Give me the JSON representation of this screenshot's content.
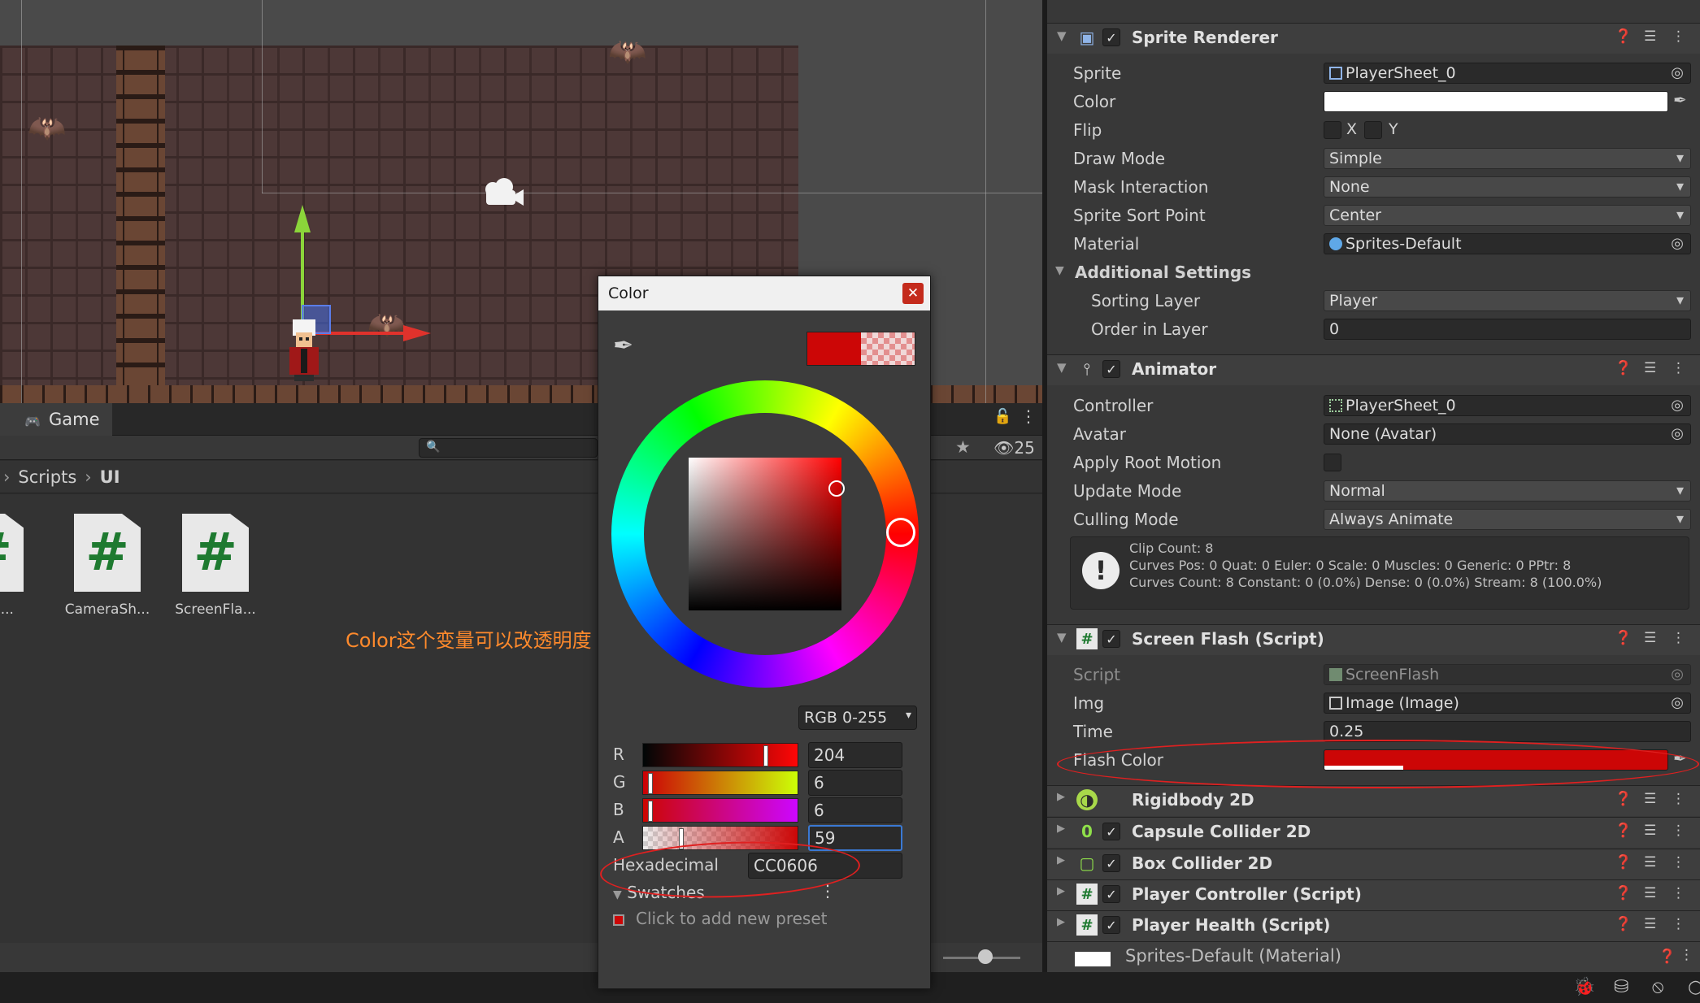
{
  "scene": {
    "game_tab_label": "Game",
    "visibility_count": "25"
  },
  "project": {
    "breadcrumb": [
      "Scripts",
      "UI"
    ],
    "assets": [
      {
        "name": "raFol...",
        "icon": "csharp-script-icon"
      },
      {
        "name": "CameraSh...",
        "icon": "csharp-script-icon"
      },
      {
        "name": "ScreenFla...",
        "icon": "csharp-script-icon"
      }
    ],
    "annotation_note": "Color这个变量可以改透明度"
  },
  "color_picker": {
    "title": "Color",
    "mode": "RGB 0-255",
    "channels": [
      {
        "label": "R",
        "value": "204",
        "level": 0.8
      },
      {
        "label": "G",
        "value": "6",
        "level": 0.024
      },
      {
        "label": "B",
        "value": "6",
        "level": 0.024
      },
      {
        "label": "A",
        "value": "59",
        "level": 0.231
      }
    ],
    "hex_label": "Hexadecimal",
    "hex_value": "CC0606",
    "swatches_label": "Swatches",
    "add_preset_label": "Click to add new preset",
    "current_color": "#cc0606"
  },
  "inspector": {
    "sprite_renderer": {
      "title": "Sprite Renderer",
      "props": [
        {
          "label": "Sprite",
          "value": "PlayerSheet_0"
        },
        {
          "label": "Color",
          "value": ""
        },
        {
          "label": "Flip",
          "value": ""
        },
        {
          "label": "Draw Mode",
          "value": "Simple"
        },
        {
          "label": "Mask Interaction",
          "value": "None"
        },
        {
          "label": "Sprite Sort Point",
          "value": "Center"
        },
        {
          "label": "Material",
          "value": "Sprites-Default"
        }
      ],
      "flip_x": "X",
      "flip_y": "Y",
      "additional_settings": "Additional Settings",
      "sorting_layer_label": "Sorting Layer",
      "sorting_layer_value": "Player",
      "order_label": "Order in Layer",
      "order_value": "0"
    },
    "animator": {
      "title": "Animator",
      "props": [
        {
          "label": "Controller",
          "value": "PlayerSheet_0"
        },
        {
          "label": "Avatar",
          "value": "None (Avatar)"
        },
        {
          "label": "Apply Root Motion",
          "value": ""
        },
        {
          "label": "Update Mode",
          "value": "Normal"
        },
        {
          "label": "Culling Mode",
          "value": "Always Animate"
        }
      ],
      "info_lines": [
        "Clip Count: 8",
        "Curves Pos: 0 Quat: 0 Euler: 0 Scale: 0 Muscles: 0 Generic: 0 PPtr: 8",
        "Curves Count: 8 Constant: 0 (0.0%) Dense: 0 (0.0%) Stream: 8 (100.0%)"
      ]
    },
    "screen_flash": {
      "title": "Screen Flash (Script)",
      "props": [
        {
          "label": "Script",
          "value": "ScreenFlash"
        },
        {
          "label": "Img",
          "value": "Image (Image)"
        },
        {
          "label": "Time",
          "value": "0.25"
        },
        {
          "label": "Flash Color",
          "value": ""
        }
      ],
      "flash_color": "#cc0606",
      "flash_alpha": 0.231
    },
    "collapsed": [
      {
        "title": "Rigidbody 2D",
        "icon": "rigidbody-icon",
        "has_check": false
      },
      {
        "title": "Capsule Collider 2D",
        "icon": "capsule-collider-icon",
        "has_check": true
      },
      {
        "title": "Box Collider 2D",
        "icon": "box-collider-icon",
        "has_check": true
      },
      {
        "title": "Player Controller (Script)",
        "icon": "script-icon",
        "has_check": true
      },
      {
        "title": "Player Health (Script)",
        "icon": "script-icon",
        "has_check": true
      }
    ],
    "material_title": "Sprites-Default (Material)"
  }
}
